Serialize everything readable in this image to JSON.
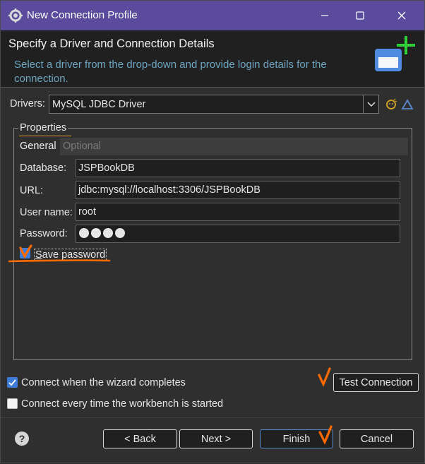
{
  "window": {
    "title": "New Connection Profile",
    "icon": "gear-icon",
    "controls": [
      "minimize-icon",
      "maximize-icon",
      "close-icon"
    ]
  },
  "banner": {
    "title": "Specify a Driver and Connection Details",
    "description": "Select a driver from the drop-down and provide login details for the connection.",
    "icon": "new-connection-icon"
  },
  "drivers": {
    "label": "Drivers:",
    "selected": "MySQL JDBC Driver",
    "icons": [
      "new-driver-icon",
      "edit-driver-icon"
    ]
  },
  "properties": {
    "group_title": "Properties",
    "tabs": [
      {
        "label": "General",
        "active": true
      },
      {
        "label": "Optional",
        "active": false
      }
    ],
    "fields": {
      "database": {
        "label": "Database:",
        "value": "JSPBookDB"
      },
      "url": {
        "label": "URL:",
        "value": "jdbc:mysql://localhost:3306/JSPBookDB"
      },
      "username": {
        "label": "User name:",
        "value": "root"
      },
      "password": {
        "label": "Password:",
        "masked_length": 4
      }
    },
    "save_password": {
      "label": "Save password",
      "checked": true
    }
  },
  "options": {
    "connect_on_finish": {
      "label": "Connect when the wizard completes",
      "checked": true
    },
    "connect_on_startup": {
      "label": "Connect every time the workbench is started",
      "checked": false
    }
  },
  "buttons": {
    "test_connection": "Test Connection",
    "back": "< Back",
    "next": "Next >",
    "finish": "Finish",
    "cancel": "Cancel"
  },
  "colors": {
    "titlebar": "#5a4b9c",
    "annotation": "#ff6a00",
    "checkbox_checked": "#3d7bd6",
    "banner_text": "#6ea6c2"
  }
}
